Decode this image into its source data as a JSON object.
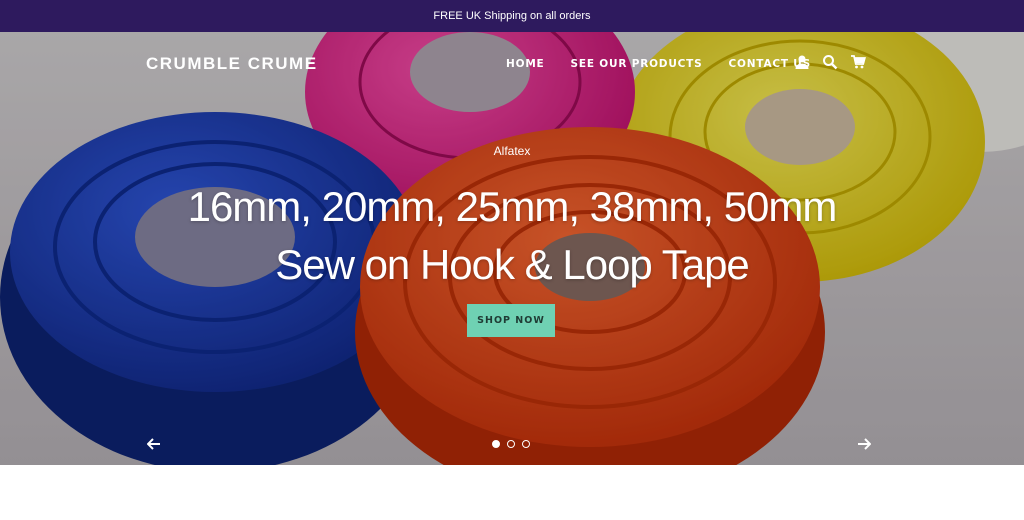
{
  "announcement": {
    "text": "FREE UK Shipping on all orders"
  },
  "header": {
    "logo": "CRUMBLE CRUME",
    "nav": [
      {
        "label": "HOME"
      },
      {
        "label": "SEE OUR PRODUCTS"
      },
      {
        "label": "CONTACT US"
      }
    ],
    "icons": [
      "account-icon",
      "search-icon",
      "cart-icon"
    ]
  },
  "hero": {
    "eyebrow": "Alfatex",
    "headline_line1": "16mm, 20mm, 25mm, 38mm, 50mm",
    "headline_line2": "Sew on Hook & Loop Tape",
    "cta_label": "SHOP NOW",
    "slides_total": 3,
    "active_slide": 1,
    "prev_icon": "arrow-left-icon",
    "next_icon": "arrow-right-icon"
  },
  "colors": {
    "announcement_bg": "#2e1a5e",
    "cta_bg": "#6fd1b3",
    "roll_blue": "#1d3fb8",
    "roll_orange": "#f2461b",
    "roll_pink": "#ef1f93",
    "roll_yellow": "#f1de0d"
  }
}
